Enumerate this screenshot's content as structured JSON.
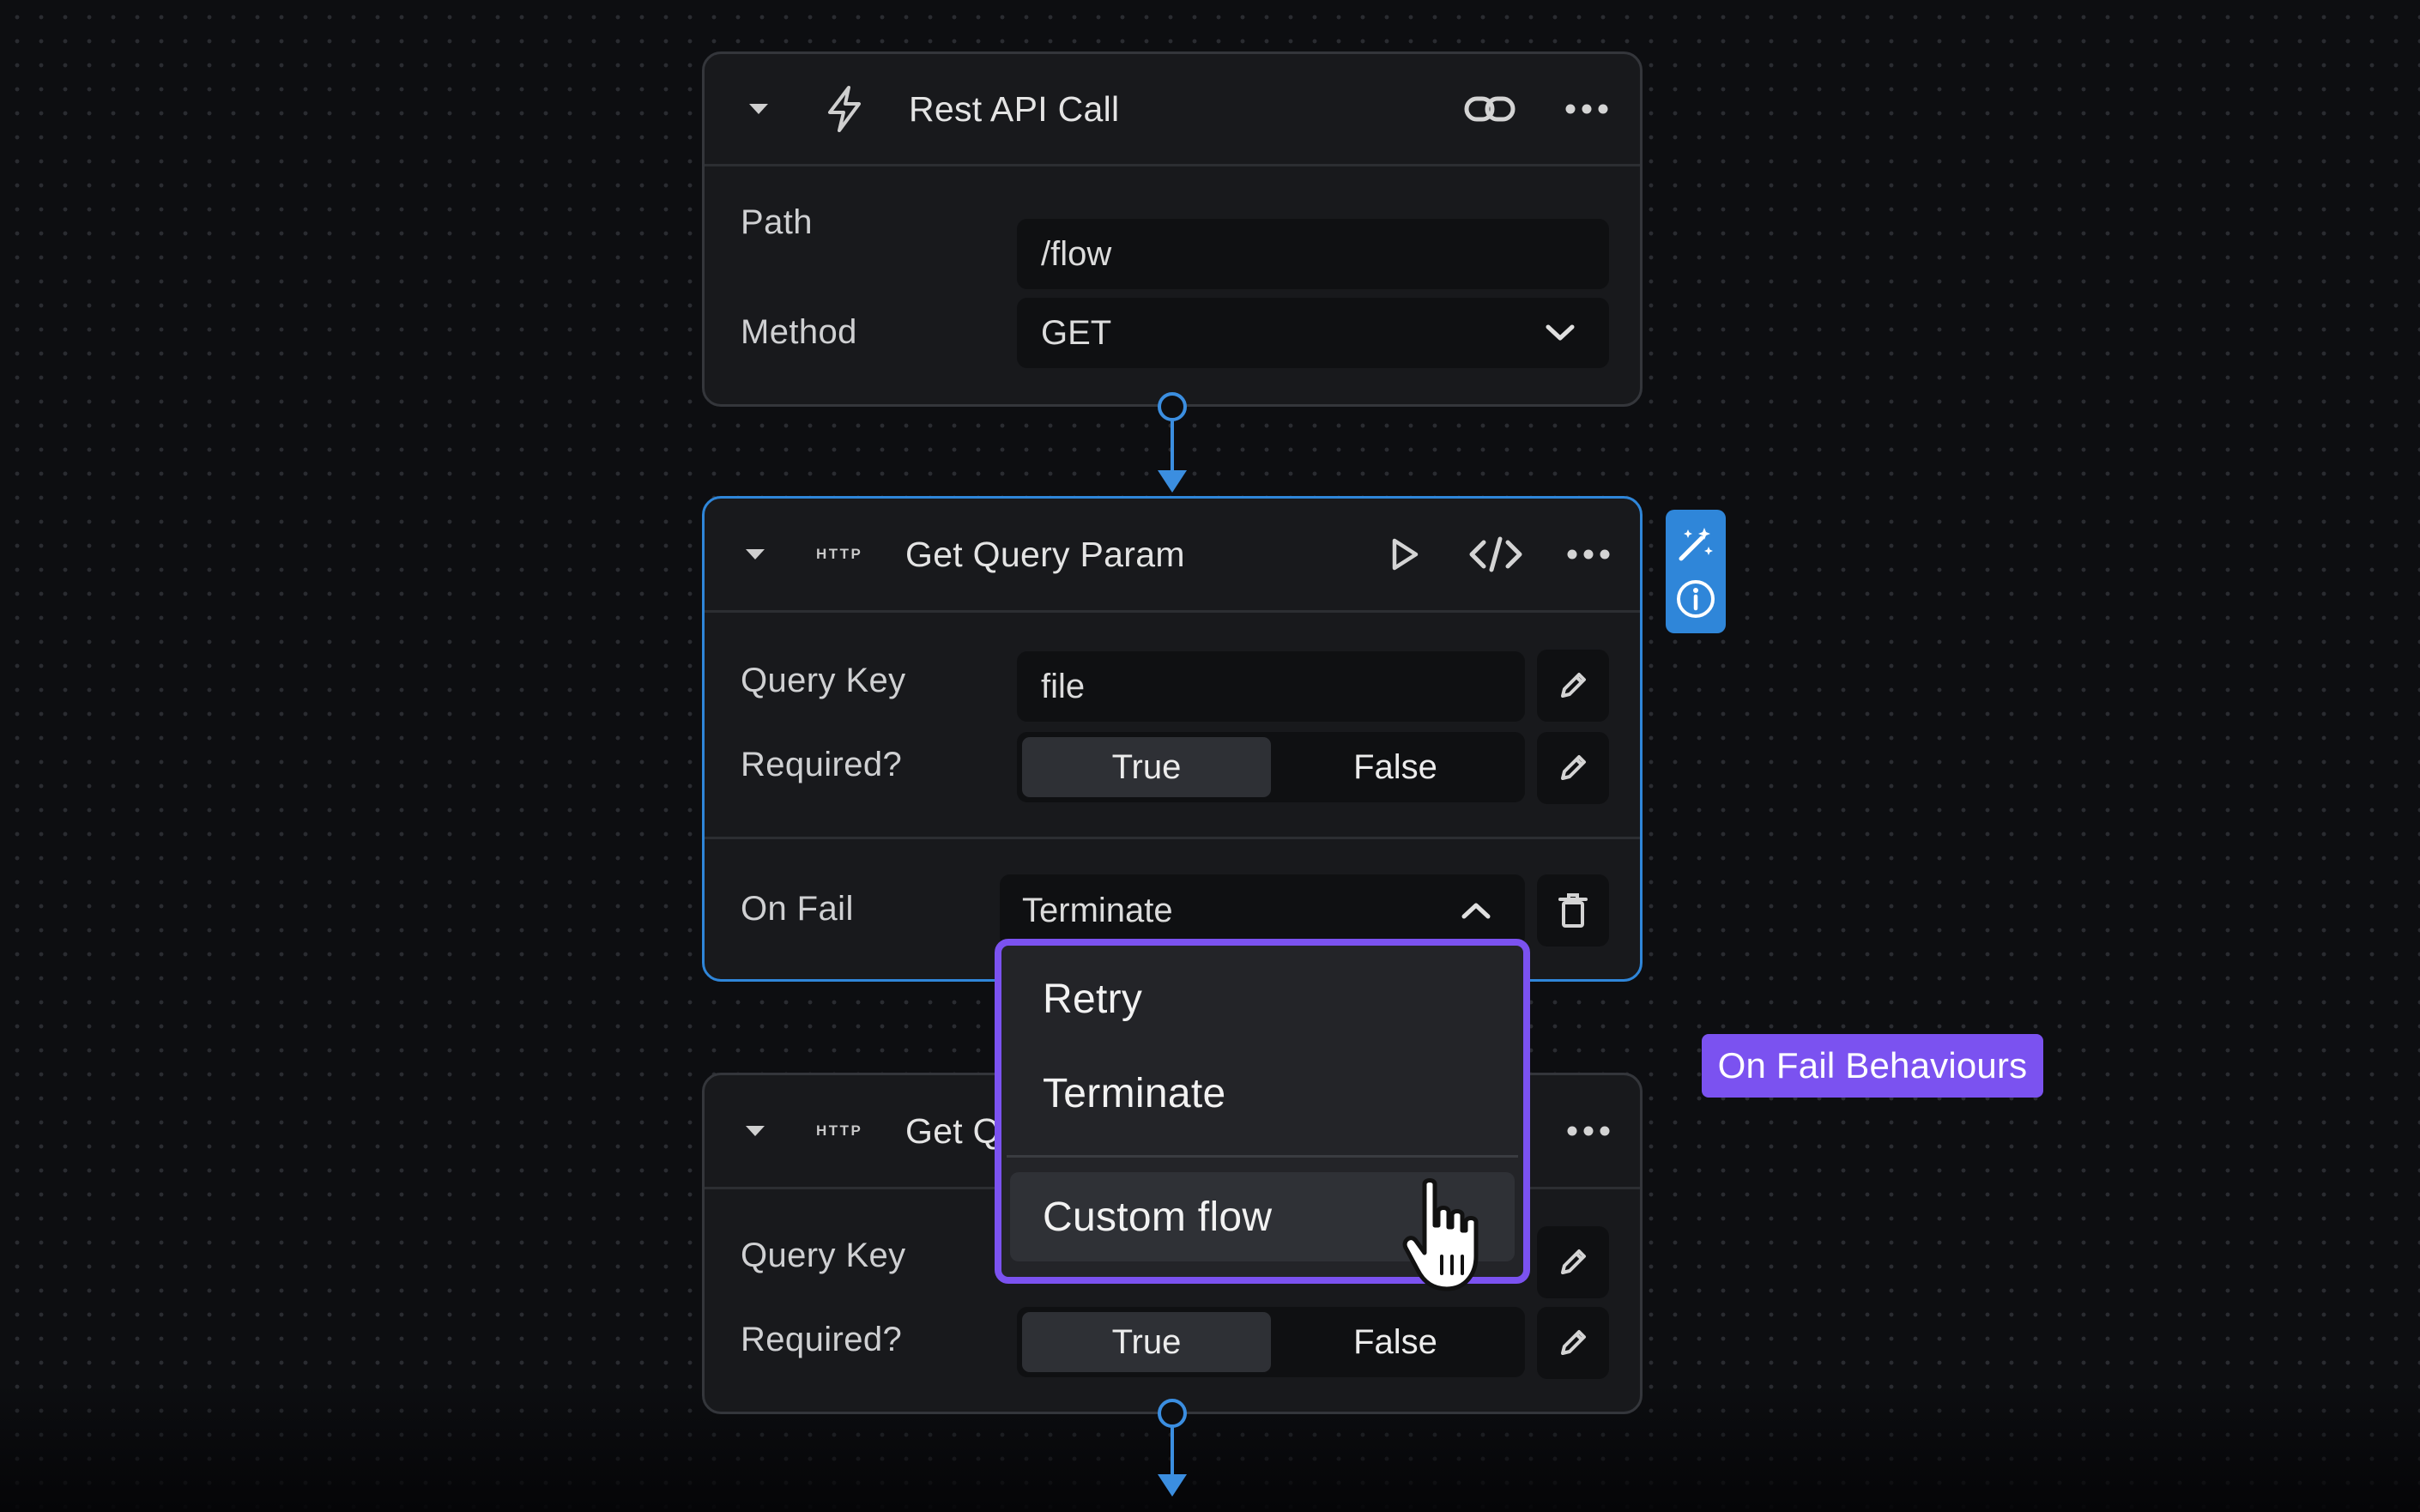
{
  "nodes": [
    {
      "title": "Rest API Call",
      "icon": "lightning-icon",
      "fields": {
        "path_label": "Path",
        "path_value": "/flow",
        "method_label": "Method",
        "method_value": "GET"
      }
    },
    {
      "title": "Get Query Param",
      "badge": "HTTP",
      "query_key_label": "Query Key",
      "query_key_value": "file",
      "required_label": "Required?",
      "required_options": [
        "True",
        "False"
      ],
      "required_selected": "True",
      "on_fail_label": "On Fail",
      "on_fail_value": "Terminate"
    },
    {
      "title": "Get Q",
      "badge": "HTTP",
      "query_key_label": "Query Key",
      "required_label": "Required?",
      "required_options": [
        "True",
        "False"
      ],
      "required_selected": "True"
    }
  ],
  "on_fail_dropdown": {
    "options": [
      "Retry",
      "Terminate",
      "Custom flow"
    ],
    "hovered": "Custom flow"
  },
  "tooltip": "On Fail Behaviours",
  "colors": {
    "accent_blue": "#2f86d9",
    "accent_purple": "#7b52f0",
    "background": "#0d0e11",
    "node_bg": "#18191c"
  }
}
